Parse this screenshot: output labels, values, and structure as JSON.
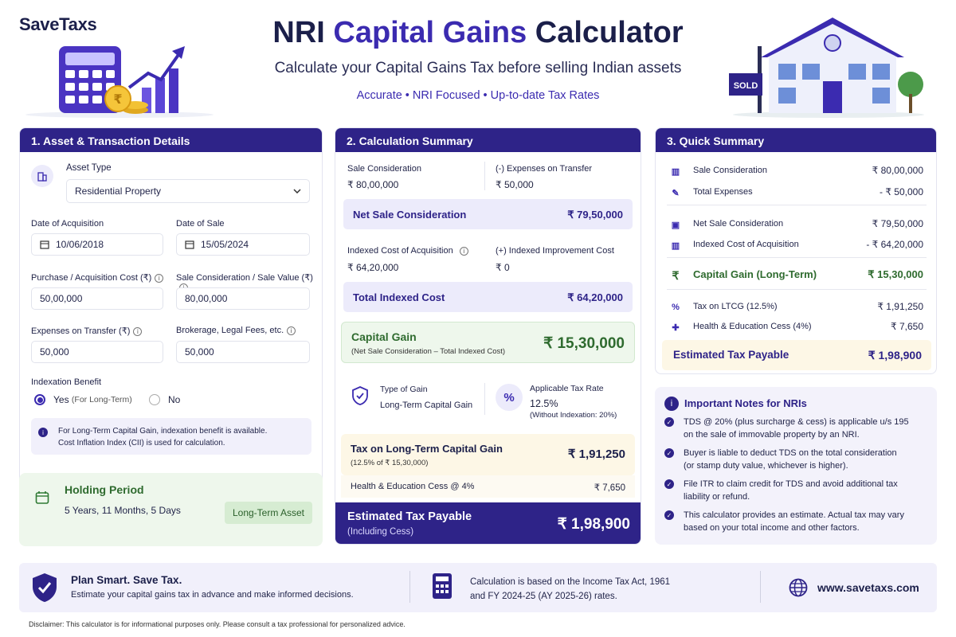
{
  "header": {
    "brand": "SaveTaxs",
    "title_part1": "NRI",
    "title_part2": "Capital Gains",
    "title_part3": "Calculator",
    "subtitle": "Calculate your Capital Gains Tax before selling Indian assets",
    "tagline": "Accurate • NRI Focused • Up-to-date Tax Rates",
    "sold_sign": "SOLD"
  },
  "section1": {
    "title": "1. Asset & Transaction Details",
    "asset_type_label": "Asset Type",
    "asset_type_value": "Residential Property",
    "acq_date_label": "Date of Acquisition",
    "acq_date_value": "10/06/2018",
    "sale_date_label": "Date of Sale",
    "sale_date_value": "15/05/2024",
    "purchase_label": "Purchase / Acquisition Cost (₹)",
    "purchase_value": "50,00,000",
    "sale_label": "Sale Consideration / Sale Value (₹)",
    "sale_value": "80,00,000",
    "expenses_label": "Expenses on Transfer (₹)",
    "expenses_value": "50,000",
    "brokerage_label": "Brokerage, Legal Fees, etc.",
    "brokerage_value": "50,000",
    "indexation_label": "Indexation Benefit",
    "yes_label": "Yes",
    "yes_note": "(For Long-Term)",
    "no_label": "No",
    "info_line1": "For Long-Term Capital Gain, indexation benefit is available.",
    "info_line2": "Cost Inflation Index (CII) is used for calculation.",
    "holding_title": "Holding Period",
    "holding_value": "5 Years, 11 Months, 5 Days",
    "holding_badge": "Long-Term Asset"
  },
  "section2": {
    "title": "2. Calculation Summary",
    "sale_consideration_label": "Sale Consideration",
    "sale_consideration_value": "₹ 80,00,000",
    "expenses_label": "(-) Expenses on Transfer",
    "expenses_value": "₹ 50,000",
    "net_sale_label": "Net Sale Consideration",
    "net_sale_value": "₹ 79,50,000",
    "indexed_cost_label": "Indexed Cost of Acquisition",
    "indexed_cost_value": "₹ 64,20,000",
    "improvement_label": "(+) Indexed Improvement Cost",
    "improvement_value": "₹ 0",
    "total_indexed_label": "Total Indexed Cost",
    "total_indexed_value": "₹ 64,20,000",
    "capital_gain_label": "Capital Gain",
    "capital_gain_note": "(Net Sale Consideration – Total Indexed Cost)",
    "capital_gain_value": "₹ 15,30,000",
    "type_gain_label": "Type of Gain",
    "type_gain_value": "Long-Term Capital Gain",
    "tax_rate_label": "Applicable Tax Rate",
    "tax_rate_value": "12.5%",
    "tax_rate_note": "(Without Indexation: 20%)",
    "ltcg_label": "Tax on Long-Term Capital Gain",
    "ltcg_note": "(12.5% of ₹ 15,30,000)",
    "ltcg_value": "₹ 1,91,250",
    "cess_label": "Health & Education Cess @ 4%",
    "cess_value": "₹ 7,650",
    "payable_label": "Estimated Tax Payable",
    "payable_note": "(Including Cess)",
    "payable_value": "₹ 1,98,900"
  },
  "section3": {
    "title": "3. Quick Summary",
    "rows": [
      {
        "icon": "building-icon",
        "label": "Sale Consideration",
        "value": "₹ 80,00,000"
      },
      {
        "icon": "pen-icon",
        "label": "Total Expenses",
        "value": "- ₹ 50,000"
      },
      {
        "icon": "wallet-icon",
        "label": "Net Sale Consideration",
        "value": "₹ 79,50,000"
      },
      {
        "icon": "chart-icon",
        "label": "Indexed Cost of Acquisition",
        "value": "- ₹ 64,20,000"
      },
      {
        "icon": "rupee-icon",
        "label": "Capital Gain (Long-Term)",
        "value": "₹ 15,30,000"
      },
      {
        "icon": "percent-icon",
        "label": "Tax on LTCG (12.5%)",
        "value": "₹ 1,91,250"
      },
      {
        "icon": "medical-icon",
        "label": "Health & Education Cess (4%)",
        "value": "₹ 7,650"
      }
    ],
    "payable_label": "Estimated Tax Payable",
    "payable_value": "₹ 1,98,900"
  },
  "notes": {
    "title": "Important Notes for NRIs",
    "items": [
      {
        "l1": "TDS @ 20% (plus surcharge & cess) is applicable u/s 195",
        "l2": "on the sale of immovable property by an NRI."
      },
      {
        "l1": "Buyer is liable to deduct TDS on the total consideration",
        "l2": "(or stamp duty value, whichever is higher)."
      },
      {
        "l1": "File ITR to claim credit for TDS and avoid additional tax",
        "l2": "liability or refund."
      },
      {
        "l1": "This calculator provides an estimate. Actual tax may vary",
        "l2": "based on your total income and other factors."
      }
    ]
  },
  "footer": {
    "plan_title": "Plan Smart. Save Tax.",
    "plan_text": "Estimate your capital gains tax in advance and make informed decisions.",
    "calc_line1": "Calculation is based on the Income Tax Act, 1961",
    "calc_line2": "and FY 2024-25 (AY 2025-26) rates.",
    "website": "www.savetaxs.com",
    "disclaimer_label": "Disclaimer:",
    "disclaimer_text": "This calculator is for informational purposes only. Please consult a tax professional for personalized advice."
  }
}
